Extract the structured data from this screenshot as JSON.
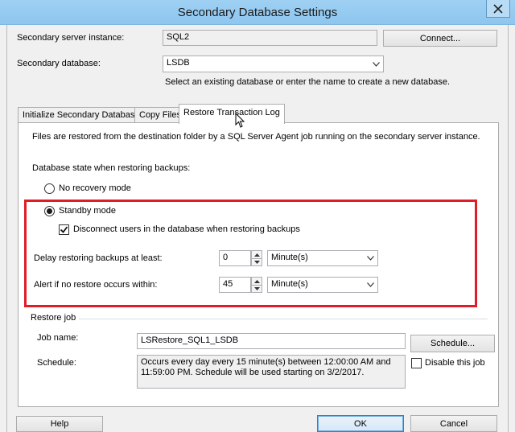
{
  "window": {
    "title": "Secondary Database Settings"
  },
  "secondary_server": {
    "label": "Secondary server instance:",
    "value": "SQL2",
    "connect_label": "Connect..."
  },
  "secondary_database": {
    "label": "Secondary database:",
    "value": "LSDB",
    "hint": "Select an existing database or enter the name to create a new database."
  },
  "tabs": [
    {
      "label": "Initialize Secondary Database"
    },
    {
      "label": "Copy Files"
    },
    {
      "label": "Restore Transaction Log"
    }
  ],
  "restore_tab": {
    "description": "Files are restored from the destination folder by a SQL Server Agent job running on the secondary server instance.",
    "db_state_label": "Database state when restoring backups:",
    "no_recovery_label": "No recovery mode",
    "standby_label": "Standby mode",
    "disconnect_label": "Disconnect users in the database when restoring backups",
    "delay_label": "Delay restoring backups at least:",
    "delay_value": "0",
    "delay_unit": "Minute(s)",
    "alert_label": "Alert if no restore occurs within:",
    "alert_value": "45",
    "alert_unit": "Minute(s)",
    "standby_selected": true,
    "disconnect_checked": true,
    "restore_job": {
      "group_label": "Restore job",
      "job_name_label": "Job name:",
      "job_name_value": "LSRestore_SQL1_LSDB",
      "schedule_button": "Schedule...",
      "schedule_label": "Schedule:",
      "schedule_text": "Occurs every day every 15 minute(s) between 12:00:00 AM and 11:59:00 PM. Schedule will be used starting on 3/2/2017.",
      "disable_label": "Disable this job",
      "disable_checked": false
    }
  },
  "buttons": {
    "help": "Help",
    "ok": "OK",
    "cancel": "Cancel"
  },
  "colors": {
    "titlebar": "#9fd0f3",
    "highlight": "#e21c26"
  }
}
